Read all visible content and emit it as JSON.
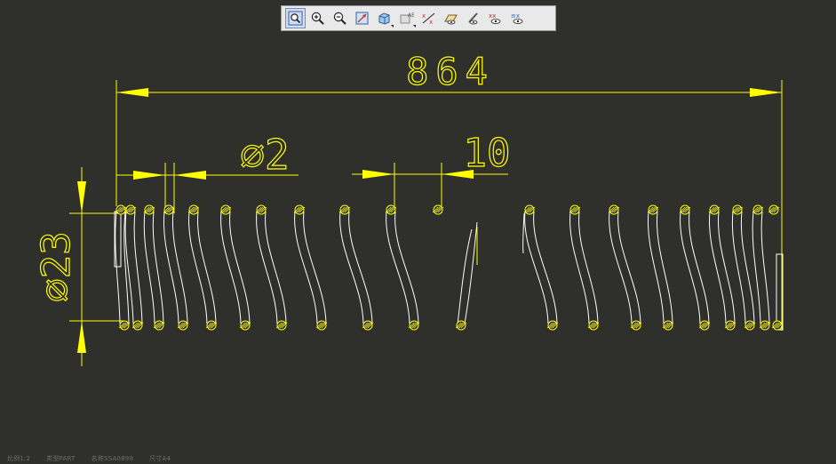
{
  "toolbar": {
    "buttons": [
      {
        "name": "zoom-window-icon",
        "title": "Zoom Window",
        "active": true
      },
      {
        "name": "zoom-in-icon",
        "title": "Zoom In"
      },
      {
        "name": "zoom-out-icon",
        "title": "Zoom Out"
      },
      {
        "name": "zoom-extents-icon",
        "title": "Zoom Extents"
      },
      {
        "name": "view-cube-icon",
        "title": "View"
      },
      {
        "name": "text-style-icon",
        "title": "Text Style"
      },
      {
        "name": "measure-icon",
        "title": "Measure"
      },
      {
        "name": "layer-hide-icon",
        "title": "Hide Layer"
      },
      {
        "name": "layer-pen-icon",
        "title": "Layer Edit"
      },
      {
        "name": "layer-off-icon",
        "title": "Layers Off"
      },
      {
        "name": "layer-on-icon",
        "title": "Layers On"
      }
    ]
  },
  "drawing": {
    "overall_length": "864",
    "wire_diameter": "∅2",
    "pitch": "10",
    "outer_diameter": "∅23",
    "colors": {
      "background": "#2f2f2b",
      "dimension": "#ffff00",
      "geometry": "#ffffff"
    }
  },
  "status": {
    "scale": "比例1:2",
    "type": "类型PART",
    "name": "名称SSA0899",
    "size": "尺寸A4"
  }
}
